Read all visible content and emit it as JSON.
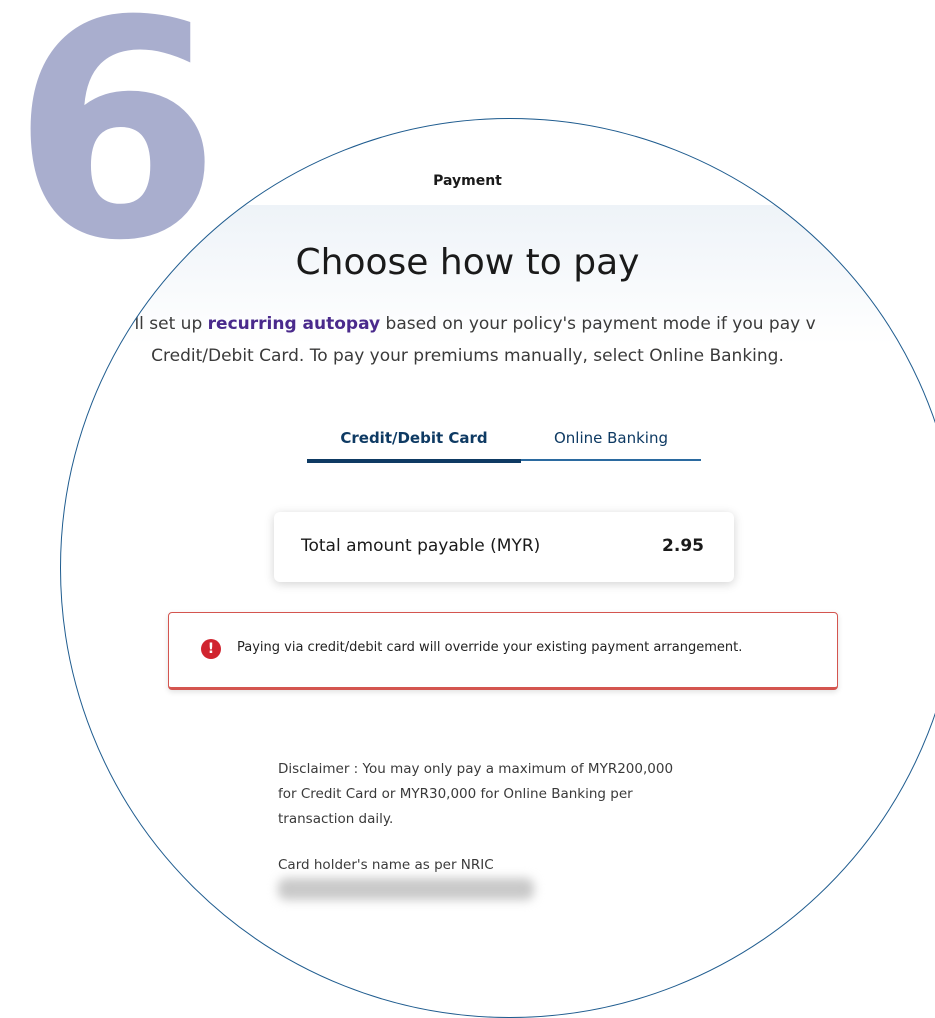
{
  "step_number": "6",
  "header": {
    "title": "Payment"
  },
  "main": {
    "heading": "Choose how to pay",
    "intro": {
      "line1_prefix": "e'll set up ",
      "line1_highlight": "recurring autopay",
      "line1_suffix": " based on your policy's payment mode if you pay v",
      "line2": "Credit/Debit Card. To pay your premiums manually, select Online Banking."
    },
    "tabs": [
      {
        "label": "Credit/Debit Card",
        "active": true
      },
      {
        "label": "Online Banking",
        "active": false
      }
    ],
    "amount": {
      "label": "Total amount payable (MYR)",
      "value": "2.95"
    },
    "alert": {
      "icon": "exclamation-icon",
      "text": "Paying via credit/debit card will override your existing payment arrangement."
    },
    "disclaimer": {
      "line1": "Disclaimer : You may only pay a maximum of MYR200,000",
      "line2": "for Credit Card or MYR30,000 for Online Banking per",
      "line3": "transaction daily."
    },
    "card_holder": {
      "label": "Card holder's name as per NRIC"
    }
  },
  "colors": {
    "step_number": "#a9aece",
    "lens_border": "#1f5c8f",
    "highlight": "#4a2a8c",
    "tab_active": "#0e3a63",
    "alert_border": "#d4554f",
    "alert_icon": "#d0242f"
  }
}
